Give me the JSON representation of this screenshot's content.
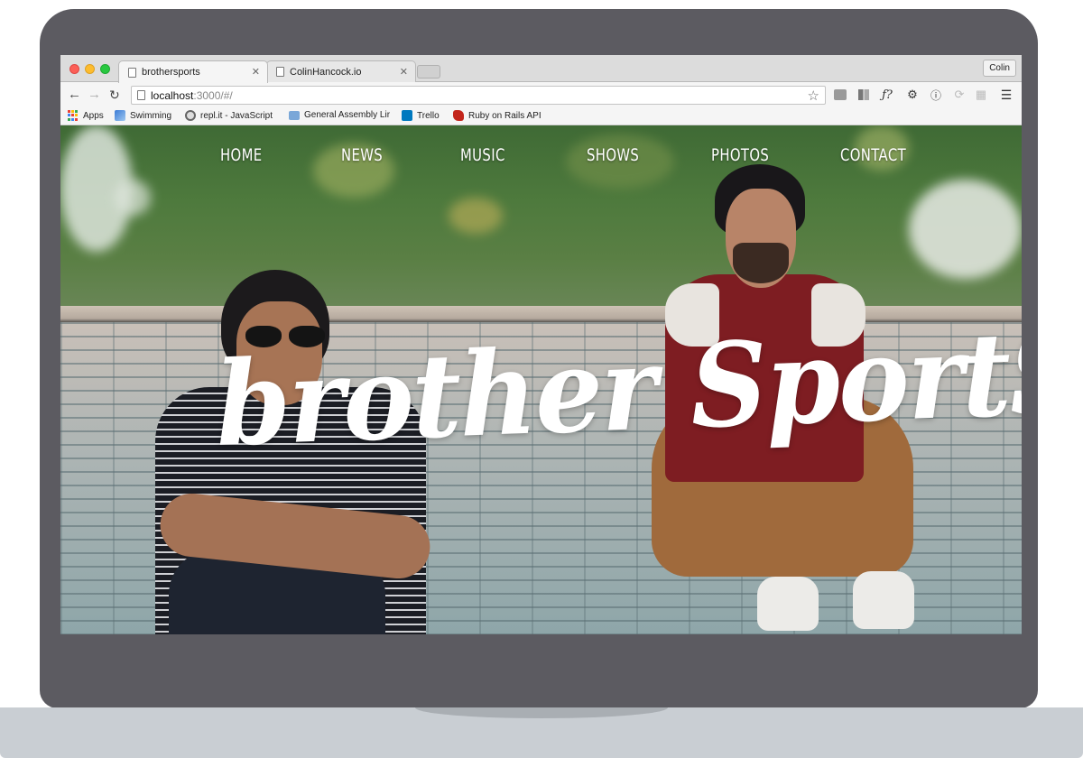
{
  "browser": {
    "tabs": [
      {
        "title": "brothersports",
        "active": true
      },
      {
        "title": "ColinHancock.io",
        "active": false
      }
    ],
    "profile_name": "Colin",
    "url": {
      "host": "localhost",
      "path": ":3000/#/"
    },
    "extensions": [
      "image-ext-icon",
      "reader-ext-icon",
      "font-ext-icon",
      "gear-icon",
      "info-icon",
      "sync-icon",
      "grid-ext-icon",
      "menu-icon"
    ],
    "bookmarks": [
      {
        "label": "Apps",
        "icon": "apps-grid-icon"
      },
      {
        "label": "Swimming",
        "icon": "swimming-icon"
      },
      {
        "label": "repl.it - JavaScript",
        "icon": "replit-icon"
      },
      {
        "label": "General Assembly Lir",
        "icon": "folder-icon"
      },
      {
        "label": "Trello",
        "icon": "trello-icon"
      },
      {
        "label": "Ruby on Rails API",
        "icon": "rails-icon"
      }
    ]
  },
  "site": {
    "nav": [
      "HOME",
      "NEWS",
      "MUSIC",
      "SHOWS",
      "PHOTOS",
      "CONTACT"
    ],
    "hero_title": "brother SportS"
  },
  "colors": {
    "frame": "#5c5b61",
    "base": "#c9ced3",
    "nav_text": "#ffffff",
    "hero_text": "#ffffff"
  }
}
